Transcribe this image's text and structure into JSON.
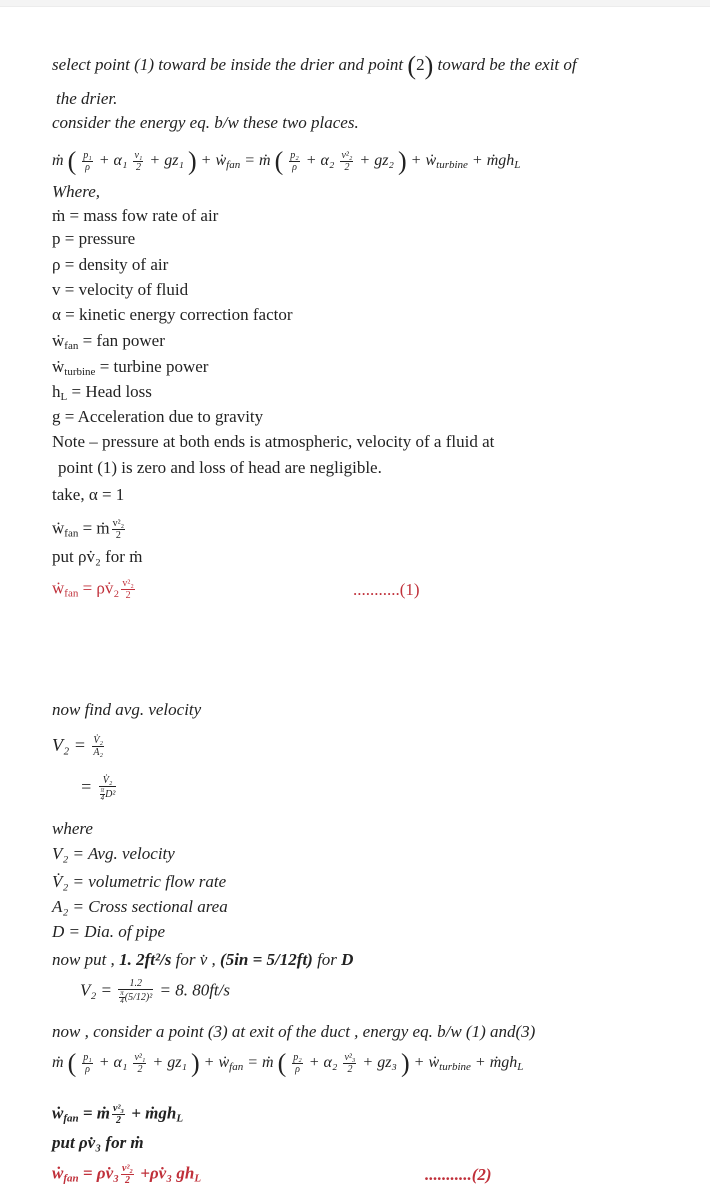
{
  "document": {
    "intro": {
      "line1_pre": "select point",
      "line1_p1": "(1)",
      "line1_mid": "toward be inside the drier and point",
      "line1_p2": "2",
      "line1_post": "toward be the exit of",
      "line2": "the drier.",
      "line3": "consider the energy eq.  b/w these two places."
    },
    "energy_eq_1": {
      "lhs": "ṁ",
      "p1": "p₁",
      "rho": "ρ",
      "alpha1": "α₁",
      "v1": "v₁",
      "two": "2",
      "gz1": "gz₁",
      "wfan": "ẇ",
      "wfan_sub": "fan",
      "rhs": "= ṁ",
      "p2": "p₂",
      "alpha2": "α₂",
      "v2sq": "v²₂",
      "gz2": "gz₂",
      "wturb": "ẇ",
      "wturb_sub": "turbine",
      "mghl": "+ ṁgh",
      "mghl_sub": "L"
    },
    "where": {
      "heading": "Where,",
      "items": [
        {
          "sym": "ṁ",
          "sub": "",
          "def": "= mass  fow  rate  of  air"
        },
        {
          "sym": "p",
          "sub": "",
          "def": "= pressure"
        },
        {
          "sym": "ρ",
          "sub": "",
          "def": "= density  of  air"
        },
        {
          "sym": "v",
          "sub": "",
          "def": "= velocity  of  fluid"
        },
        {
          "sym": "α",
          "sub": "",
          "def": "= kinetic  energy  correction  factor"
        },
        {
          "sym": "ẇ",
          "sub": "fan",
          "def": "= fan  power"
        },
        {
          "sym": "ẇ",
          "sub": "turbine",
          "def": "= turbine   power"
        },
        {
          "sym": "h",
          "sub": "L",
          "def": " = Head  loss"
        },
        {
          "sym": "g",
          "sub": "",
          "def": "= Acceleration  due  to  gravity"
        }
      ],
      "note_line1": "Note – pressure  at  both  ends  is  atmospheric,  velocity  of a  fluid  at",
      "note_line2": "point  (1)  is  zero  and  loss  of  head  are  negligible.",
      "take_alpha": "take, α = 1"
    },
    "simplify_1": {
      "wfan_eq": "ẇ",
      "wfan_sub": "fan",
      "eq_rhs": "= ṁ",
      "num": "v²₂",
      "den": "2",
      "put_line": "put   ρv̇₂  for  ṁ",
      "result_lhs": "ẇ",
      "result_sub": "fan",
      "result_rhs": "=  ρv̇₂",
      "result_num": "v²₂",
      "result_den": "2",
      "ref": "...........(1)"
    },
    "avg_velocity": {
      "heading": "now find avg.  velocity",
      "v2": "V₂",
      "eq": "=",
      "frac1_num": "V̇₂",
      "frac1_den": "A₂",
      "frac2_num": "V̇₂",
      "frac2_den_pi": "π",
      "frac2_den_4": "4",
      "frac2_den_d": "D²",
      "where_heading": "where",
      "defs": [
        {
          "sym": "V₂",
          "def": "= Avg.  velocity"
        },
        {
          "sym": "V̇₂",
          "def": "= volumetric flow rate"
        },
        {
          "sym": "A₂",
          "def": "=  Cross sectional area"
        },
        {
          "sym": "D",
          "def": "=  Dia.  of pipe"
        }
      ],
      "put_pre": "now put ,",
      "put_flow": "1. 2ft²/s",
      "put_for_v": "for v̇ ,",
      "put_d": "(5in = 5/12ft)",
      "put_for_d": "for",
      "put_d_sym": "D",
      "calc_v2": "V₂",
      "calc_num": "1.2",
      "calc_den": "(5/12)²",
      "calc_result": "= 8. 80ft/s"
    },
    "point3": {
      "line": "now ,  consider a point (3) at exit of the duct  ,  energy eq.  b/w  (1) and(3)",
      "eq": {
        "lhs": "ṁ",
        "p1": "p₁",
        "rho": "ρ",
        "alpha1": "α₁",
        "v1sq": "v²₁",
        "two": "2",
        "gz1": "gz₁",
        "wfan": "ẇ",
        "wfan_sub": "fan",
        "rhs": "= ṁ",
        "p2": "p₂",
        "alpha2": "α₂",
        "v3sq": "v²₃",
        "gz3": "gz₃",
        "wturb": "ẇ",
        "wturb_sub": "turbine",
        "mghl": "+ ṁgh",
        "mghl_sub": "L"
      },
      "simplified_lhs": "ẇ",
      "simplified_sub": "fan",
      "simplified_rhs": "= ṁ",
      "simplified_num": "v²₃",
      "simplified_den": "2",
      "simplified_tail": "+ ṁgh",
      "simplified_tail_sub": "L",
      "put_line": "put  ρv̇₃ for ṁ",
      "result_lhs": "ẇ",
      "result_sub": "fan",
      "result_rhs": "=  ρv̇₃",
      "result_num": "v²₂",
      "result_den": "2",
      "result_tail": "+ρv̇₃ gh",
      "result_tail_sub": "L",
      "ref": "...........(2)"
    },
    "colors": {
      "text": "#222222",
      "highlight": "#c0303a"
    }
  }
}
